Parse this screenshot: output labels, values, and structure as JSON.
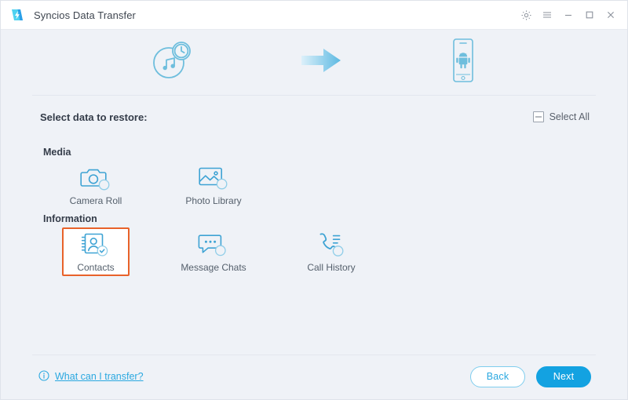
{
  "window": {
    "title": "Syncios Data Transfer",
    "logo_icon": "syncios-logo-icon",
    "controls": [
      {
        "name": "settings-button",
        "icon": "gear-icon"
      },
      {
        "name": "menu-button",
        "icon": "hamburger-menu-icon"
      },
      {
        "name": "minimize-button",
        "icon": "minimize-icon"
      },
      {
        "name": "maximize-button",
        "icon": "maximize-icon"
      },
      {
        "name": "close-button",
        "icon": "close-icon"
      }
    ]
  },
  "flow": {
    "source_icon": "itunes-backup-clock-icon",
    "arrow_icon": "arrow-right-icon",
    "target_icon": "android-phone-icon"
  },
  "select_bar": {
    "title": "Select data to restore:",
    "select_all_label": "Select All",
    "select_all_icon": "indeterminate-checkbox-icon",
    "select_all_state": "indeterminate"
  },
  "groups": [
    {
      "title": "Media",
      "items": [
        {
          "label": "Camera Roll",
          "icon": "camera-icon",
          "selected": false
        },
        {
          "label": "Photo Library",
          "icon": "photo-library-icon",
          "selected": false
        }
      ]
    },
    {
      "title": "Information",
      "items": [
        {
          "label": "Contacts",
          "icon": "contacts-icon",
          "selected": true
        },
        {
          "label": "Message Chats",
          "icon": "message-chats-icon",
          "selected": false
        },
        {
          "label": "Call History",
          "icon": "call-history-icon",
          "selected": false
        }
      ]
    }
  ],
  "footer": {
    "help_icon": "info-icon",
    "help_label": "What can I transfer?",
    "back_label": "Back",
    "next_label": "Next"
  },
  "colors": {
    "accent_blue": "#13a2e1",
    "icon_blue": "#4aa8d8",
    "selection_orange": "#e8622a",
    "body_background": "#eff2f7",
    "titlebar_background": "#ffffff"
  }
}
